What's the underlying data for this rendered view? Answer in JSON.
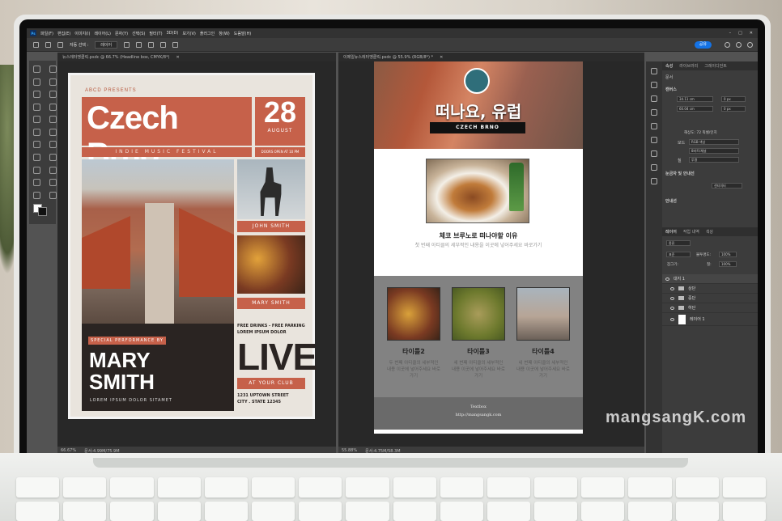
{
  "menubar": {
    "logo": "Ps",
    "items": [
      "파일(F)",
      "편집(E)",
      "이미지(I)",
      "레이어(L)",
      "문자(Y)",
      "선택(S)",
      "필터(T)",
      "3D(D)",
      "보기(V)",
      "플러그인",
      "창(W)",
      "도움말(H)"
    ]
  },
  "options": {
    "auto_select": "자동 선택 :",
    "layer_dropdown": "레이어",
    "share": "공유"
  },
  "doc1": {
    "tab": "뉴스레터맹클릭.psdc @ 66.7% (Headline box, CMYK/8*)",
    "zoom": "66.67%",
    "status": "문서:4.99M/75.9M"
  },
  "doc2": {
    "tab": "이메일뉴스레터맹클릭.psdc @ 55.9% (RGB/8*) *",
    "zoom": "55.88%",
    "status": "문서:4.75M/58.3M"
  },
  "poster": {
    "presents": "ABCD PRESENTS",
    "title": "Czech Brno",
    "day": "28",
    "month": "AUGUST",
    "festival": "INDIE MUSIC FESTIVAL",
    "doors": "DOORS OPEN AT 10 PM",
    "label1": "JOHN SMITH",
    "label2": "MARY SMITH",
    "special": "SPECIAL PERFORMANCE BY",
    "performer_line1": "MARY",
    "performer_line2": "SMITH",
    "lorem": "LOREM IPSUM DOLOR SITAMET",
    "free1": "FREE DRINKS - FREE PARKING",
    "free2": "LOREM IPSUM DOLOR",
    "live": "LIVE",
    "club": "AT YOUR CLUB",
    "addr1": "1231 UPTOWN STREET",
    "addr2": "CITY . STATE 12345"
  },
  "web": {
    "title": "떠나요, 유럽",
    "sub": "CZECH BRNO",
    "heading": "체코 브루노로 떠나야할 이유",
    "para": "첫 번째 아티클의 세부적인 내용을 이곳에 넣어주세요 바로가기",
    "cards": [
      {
        "title": "타이틀2",
        "text": "두 번째 아티클의 세부적인 내용 이곳에 넣어주세요 바로가기"
      },
      {
        "title": "타이틀3",
        "text": "세 번째 아티클의 세부적인 내용 이곳에 넣어주세요 바로가기"
      },
      {
        "title": "타이틀4",
        "text": "네 번째 아티클의 세부적인 내용 이곳에 넣어주세요 바로가기"
      }
    ],
    "footer1": "Textbox",
    "footer2": "http://mangsangk.com"
  },
  "panel": {
    "tabs": [
      "속성",
      "라이브러리",
      "그레이디언트"
    ],
    "doc_label": "문서",
    "canvas_label": "캔버스",
    "w": "34.11 cm",
    "h": "60.04 cm",
    "x": "0 px",
    "y": "0 px",
    "resolution": "해상도: 72 픽셀/인치",
    "mode_label": "모드",
    "mode_value": "RGB 색상",
    "bits": "8비트/채널",
    "fill_label": "칠",
    "fill_value": "투명",
    "rulers": "눈금자 및 안내선",
    "units": "센티미터",
    "guides": "안내선",
    "layers_tabs": [
      "레이어",
      "작업 내역",
      "색상"
    ],
    "kind": "종류",
    "blend": "표준",
    "opacity_label": "불투명도:",
    "opacity": "100%",
    "lock_label": "잠그기:",
    "fill2_label": "칠:",
    "fill2": "100%"
  },
  "layers": [
    {
      "name": "대지 1",
      "type": "artboard"
    },
    {
      "name": "상단",
      "type": "group"
    },
    {
      "name": "중단",
      "type": "group"
    },
    {
      "name": "하단",
      "type": "group"
    },
    {
      "name": "레이어 1",
      "type": "layer"
    }
  ],
  "watermark": "mangsangK.com"
}
